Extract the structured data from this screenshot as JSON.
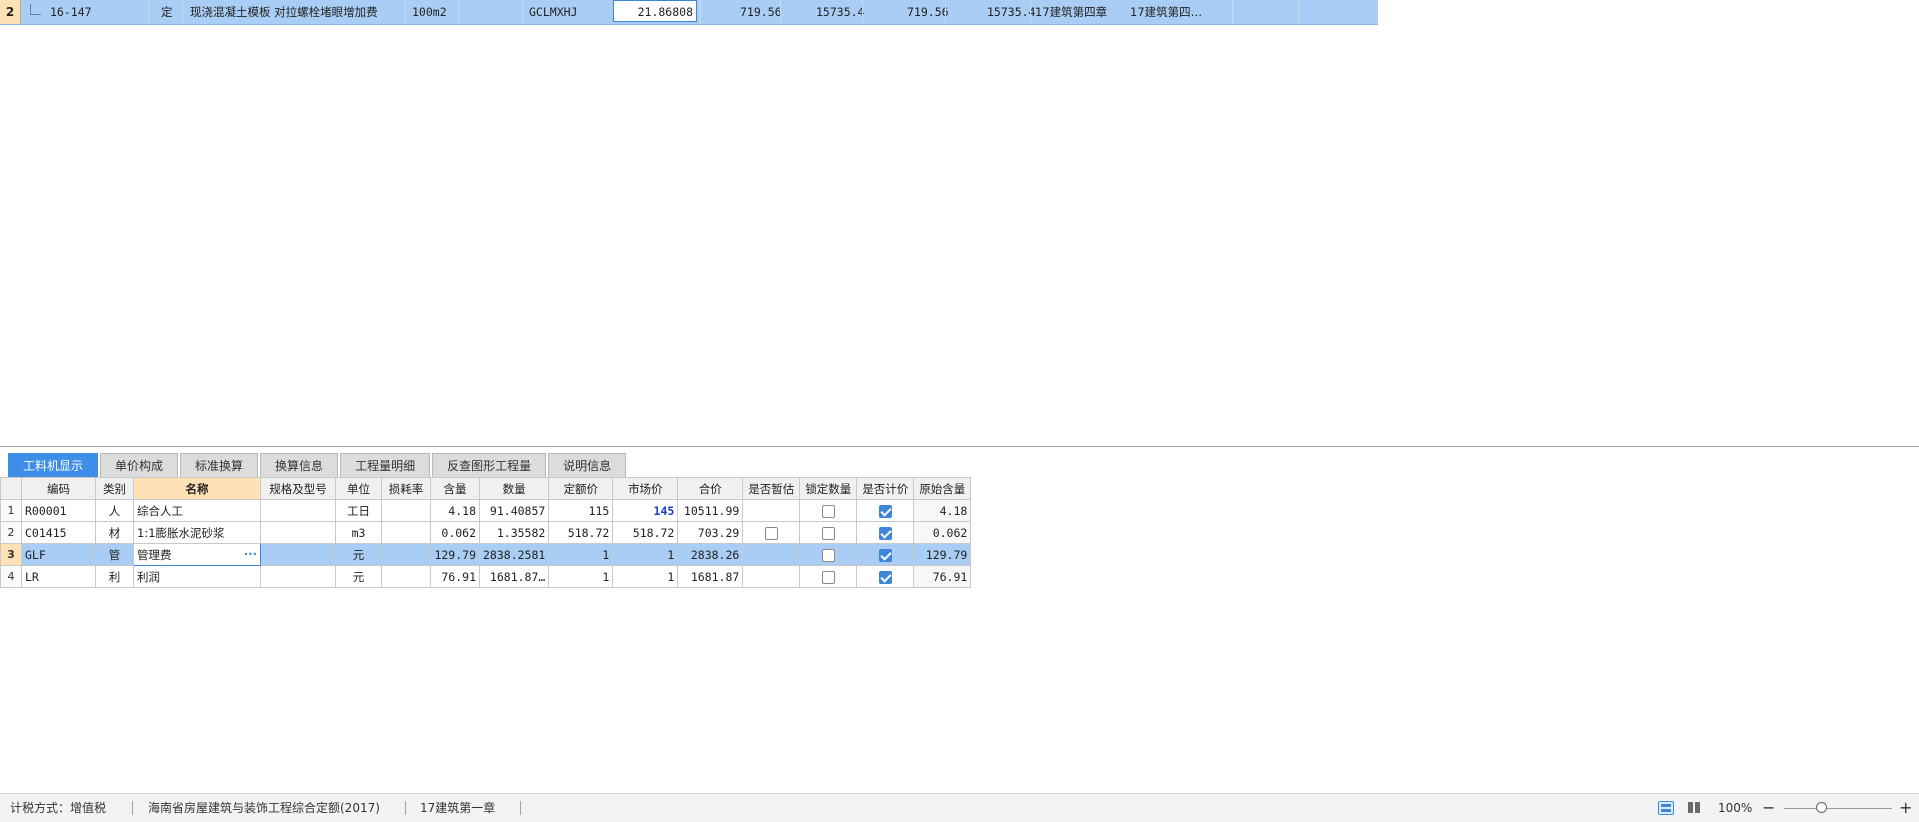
{
  "top_row": {
    "row_number": "2",
    "code": "16-147",
    "type": "定",
    "name": "现浇混凝土模板 对拉螺栓堵眼增加费",
    "unit": "100m2",
    "expr": "GCLMXHJ",
    "quantity": "21.86808",
    "unit_price": "719.56",
    "total_price": "15735.4",
    "comp_unit_price": "719.56",
    "comp_total": "15735.4",
    "chapter": "17建筑第四章",
    "chapter2": "17建筑第四…"
  },
  "tabs": [
    {
      "label": "工料机显示"
    },
    {
      "label": "单价构成"
    },
    {
      "label": "标准换算"
    },
    {
      "label": "换算信息"
    },
    {
      "label": "工程量明细"
    },
    {
      "label": "反查图形工程量"
    },
    {
      "label": "说明信息"
    }
  ],
  "grid": {
    "columns": [
      "编码",
      "类别",
      "名称",
      "规格及型号",
      "单位",
      "损耗率",
      "含量",
      "数量",
      "定额价",
      "市场价",
      "合价",
      "是否暂估",
      "锁定数量",
      "是否计价",
      "原始含量"
    ],
    "rows": [
      {
        "no": "1",
        "code": "R00001",
        "category": "人",
        "name": "综合人工",
        "spec": "",
        "unit": "工日",
        "loss": "",
        "content": "4.18",
        "qty": "91.40857",
        "quota_price": "115",
        "market_price": "145",
        "total": "10511.99",
        "provisional": "",
        "locked": false,
        "priced": true,
        "orig": "4.18"
      },
      {
        "no": "2",
        "code": "C01415",
        "category": "材",
        "name": "1:1膨胀水泥砂浆",
        "spec": "",
        "unit": "m3",
        "loss": "",
        "content": "0.062",
        "qty": "1.35582",
        "quota_price": "518.72",
        "market_price": "518.72",
        "total": "703.29",
        "provisional": false,
        "locked": false,
        "priced": true,
        "orig": "0.062"
      },
      {
        "no": "3",
        "code": "GLF",
        "category": "管",
        "name": "管理费",
        "spec": "",
        "unit": "元",
        "loss": "",
        "content": "129.79",
        "qty": "2838.2581",
        "quota_price": "1",
        "market_price": "1",
        "total": "2838.26",
        "provisional": "",
        "locked": false,
        "priced": true,
        "orig": "129.79"
      },
      {
        "no": "4",
        "code": "LR",
        "category": "利",
        "name": "利润",
        "spec": "",
        "unit": "元",
        "loss": "",
        "content": "76.91",
        "qty": "1681.87…",
        "quota_price": "1",
        "market_price": "1",
        "total": "1681.87",
        "provisional": "",
        "locked": false,
        "priced": true,
        "orig": "76.91"
      }
    ]
  },
  "status": {
    "tax_method": "计税方式：增值税",
    "quota_lib": "海南省房屋建筑与装饰工程综合定额(2017)",
    "chapter": "17建筑第一章",
    "zoom": "100%",
    "zoom_out": "−",
    "zoom_in": "+"
  },
  "colors": {
    "selection": "#a9cdf4",
    "accent": "#3d86d8",
    "header_highlight": "#ffe1b5"
  }
}
